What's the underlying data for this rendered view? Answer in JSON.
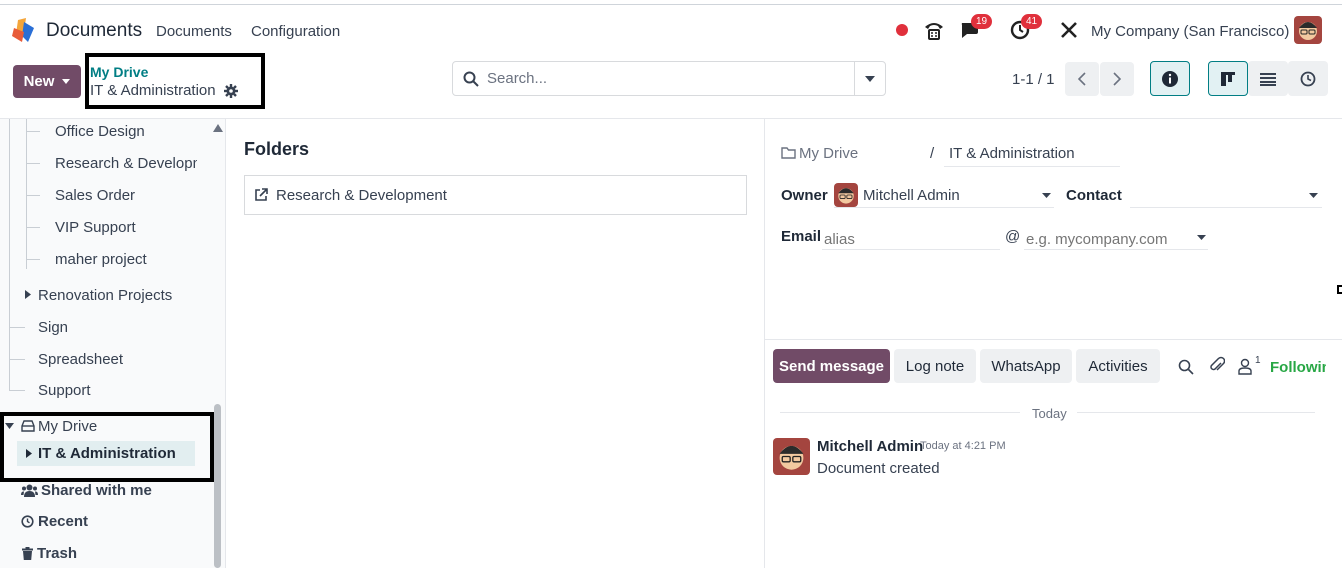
{
  "navbar": {
    "app_title": "Documents",
    "menu": [
      "Documents",
      "Configuration"
    ],
    "messages_badge": "19",
    "activities_badge": "41",
    "company": "My Company (San Francisco)"
  },
  "control": {
    "new_label": "New",
    "breadcrumb_parent": "My Drive",
    "breadcrumb_current": "IT & Administration",
    "search_placeholder": "Search...",
    "pager": "1-1 / 1"
  },
  "sidebar": {
    "children": [
      "Office Design",
      "Research & Developm",
      "Sales Order",
      "VIP Support",
      "maher project"
    ],
    "top_items": [
      "Renovation Projects",
      "Sign",
      "Spreadsheet",
      "Support"
    ],
    "my_drive": "My Drive",
    "my_drive_child": "IT & Administration",
    "shared": "Shared with me",
    "recent": "Recent",
    "trash": "Trash"
  },
  "main": {
    "folders_title": "Folders",
    "folder": "Research & Development"
  },
  "details": {
    "path_root": "My Drive",
    "path_sep": "/",
    "path_name": "IT & Administration",
    "owner_label": "Owner",
    "owner_value": "Mitchell Admin",
    "contact_label": "Contact",
    "email_label": "Email",
    "alias_placeholder": "alias",
    "at_sign": "@",
    "domain_placeholder": "e.g. mycompany.com"
  },
  "chatter": {
    "send_message": "Send message",
    "log_note": "Log note",
    "whatsapp": "WhatsApp",
    "activities": "Activities",
    "followers_count": "1",
    "following": "Followin",
    "date_sep": "Today",
    "author": "Mitchell Admin",
    "time": "Today at 4:21 PM",
    "body": "Document created"
  },
  "colors": {
    "primary": "#714b67",
    "link": "#017e84",
    "badge": "#e0303c",
    "following": "#28a745"
  }
}
